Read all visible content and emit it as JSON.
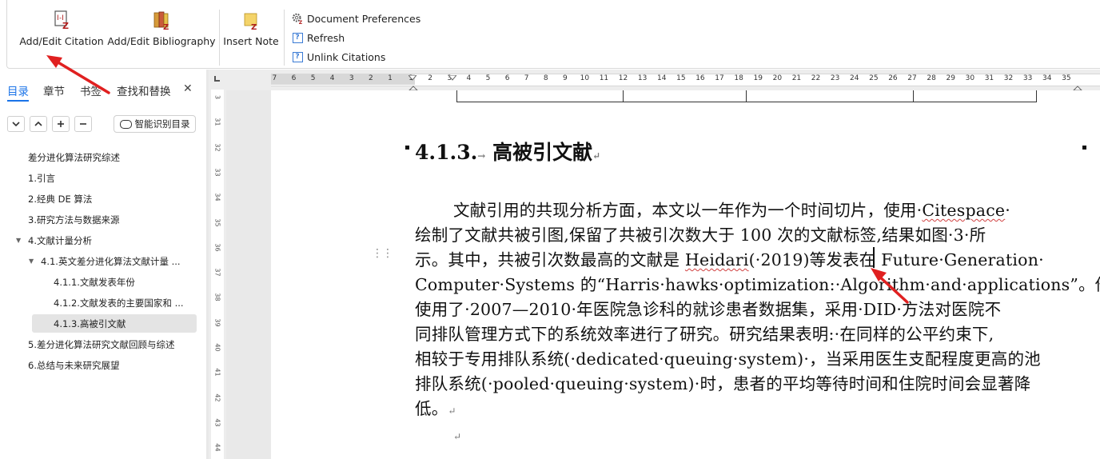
{
  "ribbon": {
    "add_edit_citation": "Add/Edit Citation",
    "add_edit_bibliography": "Add/Edit Bibliography",
    "insert_note": "Insert Note",
    "document_preferences": "Document Preferences",
    "refresh": "Refresh",
    "unlink_citations": "Unlink Citations"
  },
  "nav": {
    "tabs": [
      "目录",
      "章节",
      "书签",
      "查找和替换"
    ],
    "close_glyph": "✕",
    "smart_button": "智能识别目录",
    "toc": [
      {
        "label": "差分进化算法研究综述",
        "level": 0
      },
      {
        "label": "1.引言",
        "level": 0
      },
      {
        "label": "2.经典 DE 算法",
        "level": 0
      },
      {
        "label": "3.研究方法与数据来源",
        "level": 0
      },
      {
        "label": "4.文献计量分析",
        "level": 0,
        "expanded": true
      },
      {
        "label": "4.1.英文差分进化算法文献计量 ...",
        "level": 1,
        "expanded": true
      },
      {
        "label": "4.1.1.文献发表年份",
        "level": 2
      },
      {
        "label": "4.1.2.文献发表的主要国家和 ...",
        "level": 2
      },
      {
        "label": "4.1.3.高被引文献",
        "level": 2,
        "selected": true
      },
      {
        "label": "5.差分进化算法研究文献回顾与综述",
        "level": 0
      },
      {
        "label": "6.总结与未来研究展望",
        "level": 0
      }
    ]
  },
  "ruler": {
    "horizontal": [
      "7",
      "6",
      "5",
      "4",
      "3",
      "2",
      "1",
      "1",
      "2",
      "3",
      "4",
      "5",
      "6",
      "7",
      "8",
      "9",
      "10",
      "11",
      "12",
      "13",
      "14",
      "15",
      "16",
      "17",
      "18",
      "19",
      "20",
      "21",
      "22",
      "23",
      "24",
      "25",
      "26",
      "27",
      "28",
      "29",
      "30",
      "31",
      "32",
      "33",
      "34",
      "35"
    ],
    "vertical": [
      "3",
      "31",
      "32",
      "33",
      "34",
      "35",
      "36",
      "37",
      "38",
      "39",
      "40",
      "41",
      "42",
      "43",
      "44"
    ]
  },
  "document": {
    "heading_number": "4.1.3.",
    "heading_text": "高被引文献",
    "lines": [
      {
        "pre": "文献引用的共现分析方面，本文以一年作为一个时间切片，使用·",
        "wavy": "Citespace",
        "post": "·"
      },
      {
        "pre": "绘制了文献共被引图,保留了共被引次数大于 100 次的文献标签,结果如图·3·所",
        "wavy": "",
        "post": ""
      },
      {
        "pre": "示。其中，共被引次数最高的文献是 ",
        "wavy": "Heidari",
        "post": "(·2019)等发表在 Future·Generation·"
      },
      {
        "pre": "Computer·Systems 的“Harris·hawks·optimization:·Algorithm·and·applications”。他们",
        "wavy": "",
        "post": ""
      },
      {
        "pre": "使用了·2007—2010·年医院急诊科的就诊患者数据集，采用·DID·方法对医院不",
        "wavy": "",
        "post": ""
      },
      {
        "pre": "同排队管理方式下的系统效率进行了研究。研究结果表明:·在同样的公平约束下,",
        "wavy": "",
        "post": ""
      },
      {
        "pre": "相较于专用排队系统(·dedicated·queuing·system)·，当采用医生支配程度更高的池",
        "wavy": "",
        "post": ""
      },
      {
        "pre": "排队系统(·pooled·queuing·system)·时，患者的平均等待时间和住院时间会显著降",
        "wavy": "",
        "post": ""
      },
      {
        "pre": "低。",
        "wavy": "",
        "post": ""
      }
    ],
    "para_mark": "↵"
  },
  "colors": {
    "accent": "#1a73e8",
    "annotation_arrow": "#e02020",
    "selected_toc_bg": "#e4e4e4"
  }
}
